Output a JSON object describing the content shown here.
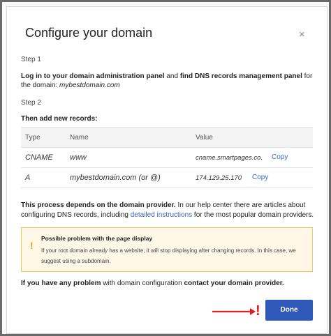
{
  "dialog": {
    "title": "Configure your domain",
    "close_glyph": "×",
    "step1_label": "Step 1",
    "step1_bold1": "Log in to your domain administration panel",
    "step1_mid": " and ",
    "step1_bold2": "find DNS records management panel",
    "step1_tail": " for the domain: ",
    "domain": "mybestdomain.com",
    "step2_label": "Step 2",
    "records_heading": "Then add new records:",
    "table": {
      "headers": [
        "Type",
        "Name",
        "Value"
      ],
      "rows": [
        {
          "type": "CNAME",
          "name": "www",
          "value": "cname.smartpages.co.",
          "copy": "Copy"
        },
        {
          "type": "A",
          "name": "mybestdomain.com (or @)",
          "value": "174.129.25.170",
          "copy": "Copy"
        }
      ]
    },
    "process_bold": "This process depends on the domain provider.",
    "process_text1": " In our help center there are articles about configuring DNS records, including ",
    "process_link": "detailed instructions",
    "process_text2": " for the most popular domain providers.",
    "warning": {
      "icon": "!",
      "title": "Possible problem with the page display",
      "text": "If your root domain already has a website, it will stop displaying after changing records. In this case, we suggest using a subdomain."
    },
    "contact_bold1": "If you have any problem",
    "contact_mid": " with domain configuration ",
    "contact_bold2": "contact your domain provider.",
    "done_label": "Done",
    "annotation_mark": "!",
    "colors": {
      "primary": "#2f58b8",
      "link": "#3a66c8",
      "warning_bg": "#fff8e6",
      "warning_border": "#f2c95c",
      "annotation": "#e02020"
    }
  }
}
